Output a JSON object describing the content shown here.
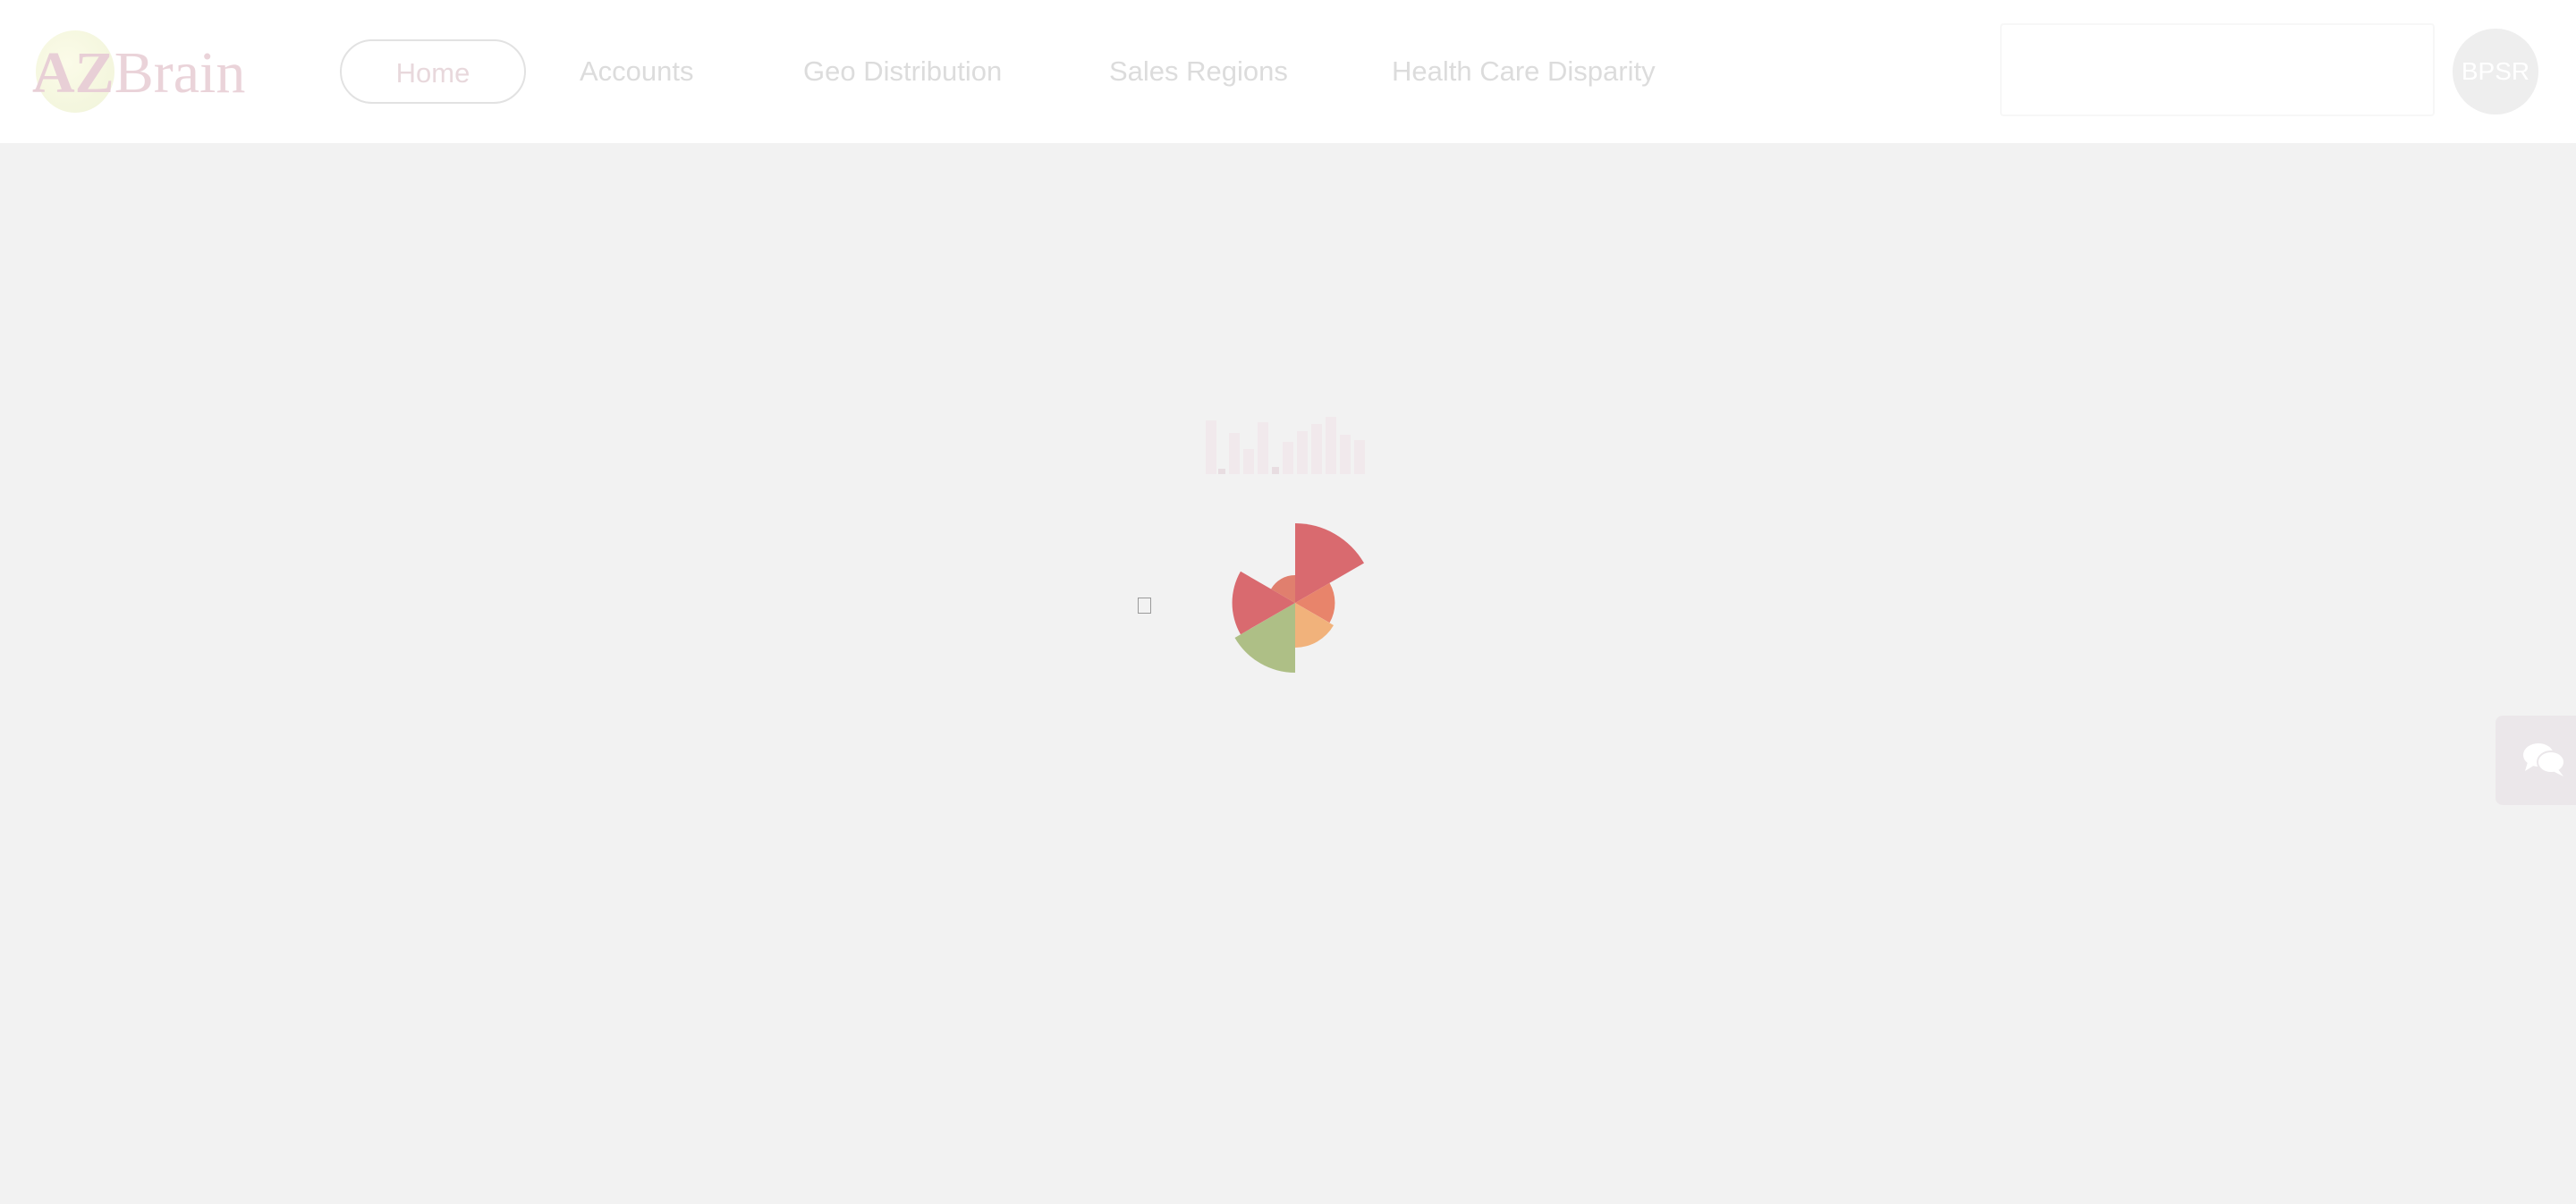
{
  "header": {
    "logo": {
      "part1": "AZ",
      "part2": "Brain"
    },
    "nav": [
      {
        "label": "Home",
        "active": true
      },
      {
        "label": "Accounts",
        "active": false
      },
      {
        "label": "Geo Distribution",
        "active": false
      },
      {
        "label": "Sales Regions",
        "active": false
      },
      {
        "label": "Health Care Disparity",
        "active": false
      }
    ],
    "search": {
      "placeholder": ""
    },
    "avatar_initials": "BPSR"
  },
  "loader": {
    "icons": [
      "bar-chart-loading-icon",
      "rose-chart-loading-icon"
    ],
    "colors": {
      "red": "#d96a6f",
      "orange": "#f1b27b",
      "coral": "#e8846b",
      "green": "#aebf86"
    }
  },
  "chat": {
    "icon": "chat-icon"
  }
}
